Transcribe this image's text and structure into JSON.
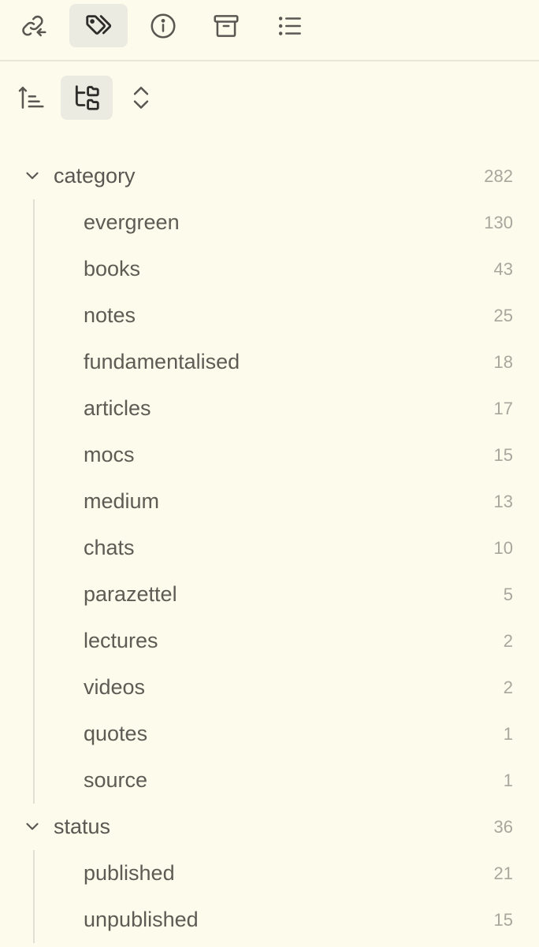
{
  "tabs": [
    {
      "icon": "link-return-icon",
      "active": false
    },
    {
      "icon": "tags-icon",
      "active": true
    },
    {
      "icon": "info-icon",
      "active": false
    },
    {
      "icon": "archive-icon",
      "active": false
    },
    {
      "icon": "list-icon",
      "active": false
    }
  ],
  "toolbar": [
    {
      "icon": "sort-ascending-icon",
      "active": false
    },
    {
      "icon": "nested-tags-icon",
      "active": true
    },
    {
      "icon": "expand-collapse-icon",
      "active": false
    }
  ],
  "groups": [
    {
      "label": "category",
      "count": "282",
      "items": [
        {
          "label": "evergreen",
          "count": "130"
        },
        {
          "label": "books",
          "count": "43"
        },
        {
          "label": "notes",
          "count": "25"
        },
        {
          "label": "fundamentalised",
          "count": "18"
        },
        {
          "label": "articles",
          "count": "17"
        },
        {
          "label": "mocs",
          "count": "15"
        },
        {
          "label": "medium",
          "count": "13"
        },
        {
          "label": "chats",
          "count": "10"
        },
        {
          "label": "parazettel",
          "count": "5"
        },
        {
          "label": "lectures",
          "count": "2"
        },
        {
          "label": "videos",
          "count": "2"
        },
        {
          "label": "quotes",
          "count": "1"
        },
        {
          "label": "source",
          "count": "1"
        }
      ]
    },
    {
      "label": "status",
      "count": "36",
      "items": [
        {
          "label": "published",
          "count": "21"
        },
        {
          "label": "unpublished",
          "count": "15"
        }
      ]
    }
  ],
  "colors": {
    "background": "#fdfbeb",
    "active_bg": "#ecebe1",
    "text": "#5e5b55",
    "muted": "#a9a69d"
  }
}
